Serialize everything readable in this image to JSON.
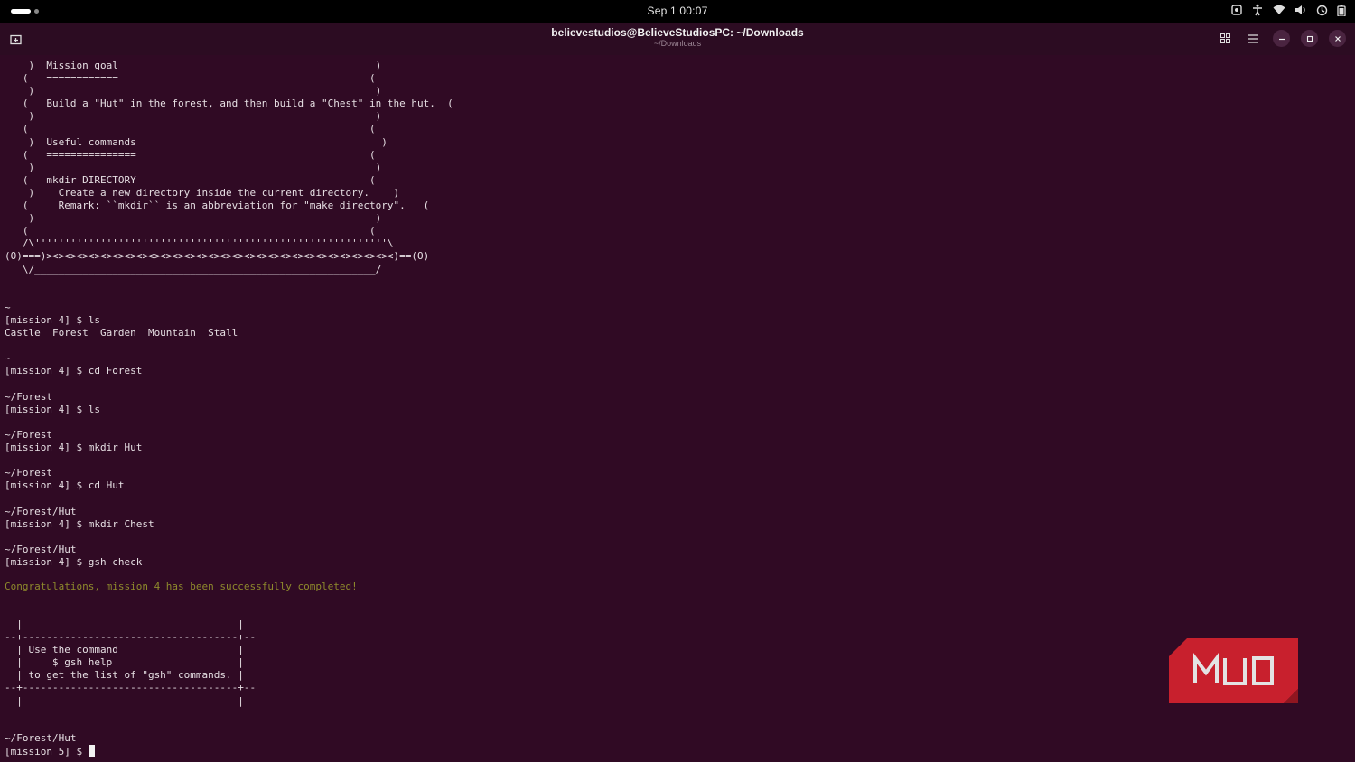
{
  "topbar": {
    "clock": "Sep 1  00:07",
    "icons": [
      "screenshot-icon",
      "accessibility-icon",
      "wifi-icon",
      "volume-icon",
      "power-icon",
      "battery-icon"
    ]
  },
  "titlebar": {
    "title": "believestudios@BelieveStudiosPC: ~/Downloads",
    "subtitle": "~/Downloads",
    "buttons": [
      "new-tab",
      "view-tabs",
      "menu",
      "minimize",
      "maximize",
      "close"
    ]
  },
  "terminal": {
    "banner": "    )  Mission goal                                           )\n   (   ============                                          (\n    )                                                         )\n   (   Build a \"Hut\" in the forest, and then build a \"Chest\" in the hut.  (\n    )                                                         )\n   (                                                         (\n    )  Useful commands                                         )\n   (   ===============                                       (\n    )                                                         )\n   (   mkdir DIRECTORY                                       (\n    )    Create a new directory inside the current directory.    )\n   (     Remark: ``mkdir`` is an abbreviation for \"make directory\".   (\n    )                                                         )\n   (                                                         (\n   /\\'''''''''''''''''''''''''''''''''''''''''''''''''''''''''''\\\n(O)===)><><><><><><><><><><><><><><><><><><><><><><><><><><><><><)==(O)\n   \\/_________________________________________________________/",
    "session": "~\n[mission 4] $ ls\nCastle  Forest  Garden  Mountain  Stall\n\n~\n[mission 4] $ cd Forest\n\n~/Forest\n[mission 4] $ ls\n\n~/Forest\n[mission 4] $ mkdir Hut\n\n~/Forest\n[mission 4] $ cd Hut\n\n~/Forest/Hut\n[mission 4] $ mkdir Chest\n\n~/Forest/Hut\n[mission 4] $ gsh check",
    "congrats": "Congratulations, mission 4 has been successfully completed!",
    "helpbox": "  |                                    |\n--+------------------------------------+--\n  | Use the command                    |\n  |     $ gsh help                     |\n  | to get the list of \"gsh\" commands. |\n--+------------------------------------+--\n  |                                    |",
    "cwd": "~/Forest/Hut",
    "prompt": "[mission 5] $ "
  },
  "watermark": {
    "text": "MUO",
    "color": "#c8202d"
  }
}
